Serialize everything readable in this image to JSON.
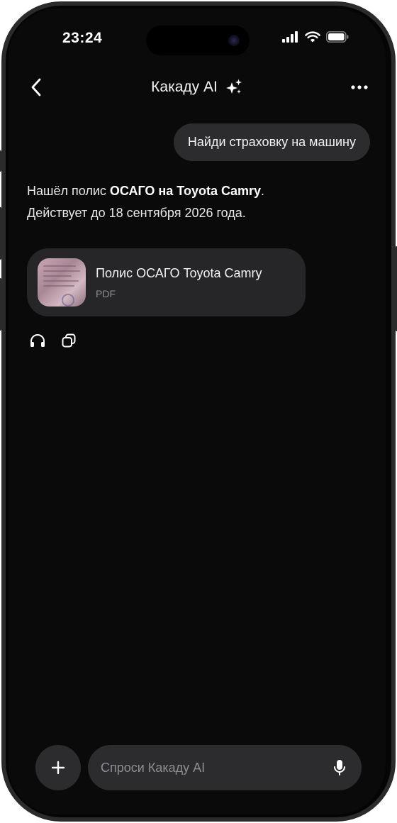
{
  "status_bar": {
    "time": "23:24"
  },
  "header": {
    "title": "Какаду AI",
    "back_icon": "chevron-left-icon",
    "title_icon": "sparkles-icon",
    "more_icon": "more-horizontal-icon"
  },
  "chat": {
    "user_message": "Найди страховку на машину",
    "ai_message": {
      "part1": "Нашёл полис ",
      "bold": "ОСАГО на Toyota Camry",
      "part2": ".",
      "line2": "Действует до 18 сентября 2026 года."
    },
    "attachment": {
      "name": "Полис ОСАГО Toyota Camry",
      "type": "PDF"
    },
    "actions": [
      {
        "icon": "headphones-icon"
      },
      {
        "icon": "copy-icon"
      }
    ]
  },
  "composer": {
    "placeholder": "Спроси Какаду AI",
    "add_icon": "plus-icon",
    "mic_icon": "microphone-icon"
  },
  "colors": {
    "background": "#0a0a0a",
    "bubble": "#2c2c2e",
    "card": "#262628",
    "text": "#f2f2f2",
    "secondary_text": "#8e8e93"
  }
}
